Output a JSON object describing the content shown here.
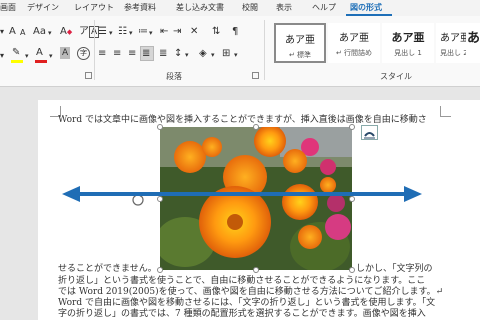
{
  "tabs": [
    {
      "label": "画面",
      "active": false
    },
    {
      "label": "デザイン",
      "active": false
    },
    {
      "label": "レイアウト",
      "active": false
    },
    {
      "label": "参考資料",
      "active": false
    },
    {
      "label": "差し込み文書",
      "active": false
    },
    {
      "label": "校閲",
      "active": false
    },
    {
      "label": "表示",
      "active": false
    },
    {
      "label": "ヘルプ",
      "active": false
    },
    {
      "label": "図の形式",
      "active": true
    }
  ],
  "ribbon": {
    "font_group": {
      "grow_font": "A",
      "shrink_font": "A",
      "change_case": "Aa",
      "clear_format": "A",
      "phonetic": "ア",
      "char_border": "A",
      "font_color_icon": "A",
      "highlight_color": "#ffff00",
      "font_color": "#e02020",
      "char_shading": "A",
      "enclose": "字"
    },
    "paragraph_group": {
      "label": "段落"
    },
    "styles_group": {
      "label": "スタイル",
      "items": [
        {
          "preview": "あア亜",
          "name": "↵ 標準",
          "selected": true
        },
        {
          "preview": "あア亜",
          "name": "↵ 行間詰め",
          "selected": false
        },
        {
          "preview": "あア亜",
          "name": "見出し 1",
          "selected": false
        },
        {
          "preview": "あア亜",
          "name": "見出し 2",
          "selected": false
        },
        {
          "preview": "あア",
          "name": "",
          "selected": false
        }
      ]
    }
  },
  "document": {
    "lines_top": [
      "Word では文章中に画像や図を挿入することができますが、挿入直後は画像を自由に移動さ"
    ],
    "line_left": "せることができません。",
    "line_right": "しかし、「文字列の",
    "lines_bottom": [
      "折り返し」という書式を使うことで、自由に移動させることができるようになります。ここ",
      "では Word 2019(2005)を使って、画像や図を自由に移動させる方法についてご紹介します。↵",
      "Word で自由に画像や図を移動させるには、「文字の折り返し」という書式を使用します。「文",
      "字の折り返し」の書式では、7 種類の配置形式を選択することができます。画像や図を挿入"
    ],
    "image": {
      "subject": "orange marigold flowers"
    },
    "arrow_color": "#1f6db5"
  }
}
